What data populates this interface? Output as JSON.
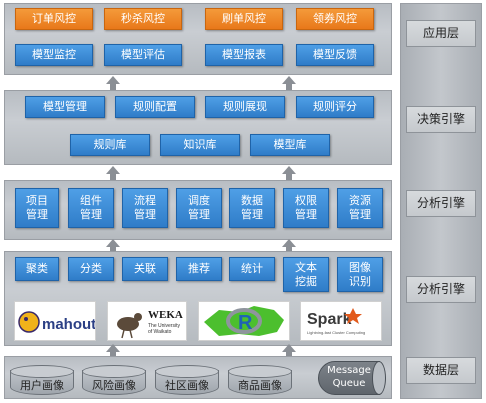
{
  "app_layer": [
    "订单风控",
    "秒杀风控",
    "刷单风控",
    "领券风控"
  ],
  "decision_layer": {
    "row1": [
      "模型监控",
      "模型评估",
      "模型报表",
      "模型反馈"
    ],
    "row2": [
      "模型管理",
      "规则配置",
      "规则展现",
      "规则评分"
    ],
    "row3": [
      "规则库",
      "知识库",
      "模型库"
    ]
  },
  "analysis_mgmt": [
    "项目\n管理",
    "组件\n管理",
    "流程\n管理",
    "调度\n管理",
    "数据\n管理",
    "权限\n管理",
    "资源\n管理"
  ],
  "analysis_algo": [
    "聚类",
    "分类",
    "关联",
    "推荐",
    "统计",
    "文本\n挖掘",
    "图像\n识别"
  ],
  "logos": {
    "mahout": "mahout",
    "weka_title": "WEKA",
    "weka_sub1": "The University",
    "weka_sub2": "of Waikato",
    "r": "R",
    "spark": "Spark",
    "spark_sub": "Lightning-fast Cluster Computing"
  },
  "data_layer": [
    "用户画像",
    "风险画像",
    "社区画像",
    "商品画像"
  ],
  "message_queue": "Message\nQueue",
  "sidebar": [
    "应用层",
    "决策引擎",
    "分析引擎",
    "分析引擎",
    "数据层"
  ],
  "colors": {
    "orange": "#f08a2a",
    "blue": "#3b8bd6",
    "layer_gray": "#c2c6cb"
  }
}
